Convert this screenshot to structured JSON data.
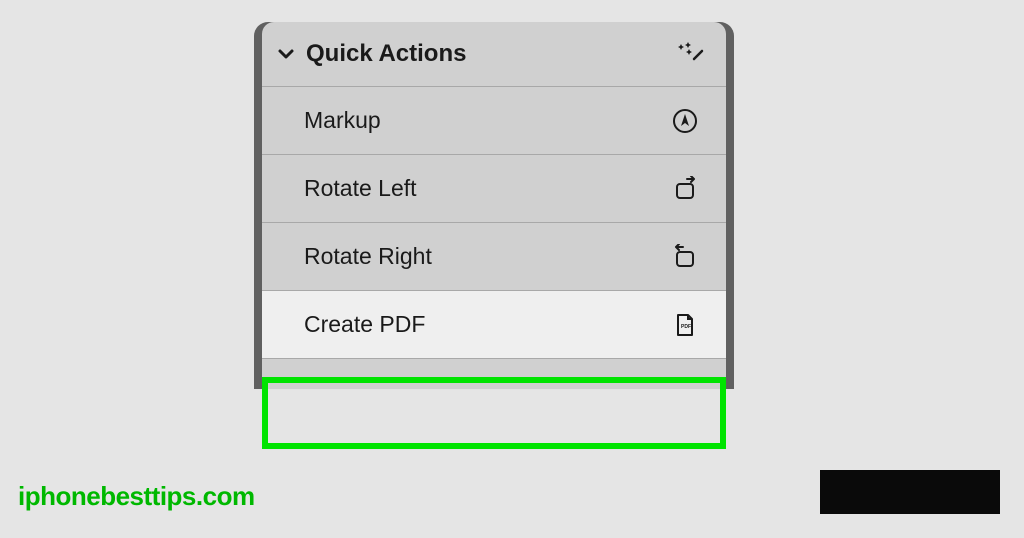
{
  "menu": {
    "header_title": "Quick Actions",
    "items": [
      {
        "label": "Markup",
        "icon": "markup-icon"
      },
      {
        "label": "Rotate Left",
        "icon": "rotate-left-icon"
      },
      {
        "label": "Rotate Right",
        "icon": "rotate-right-icon"
      },
      {
        "label": "Create PDF",
        "icon": "pdf-icon"
      }
    ]
  },
  "watermark": "iphonebesttips.com"
}
